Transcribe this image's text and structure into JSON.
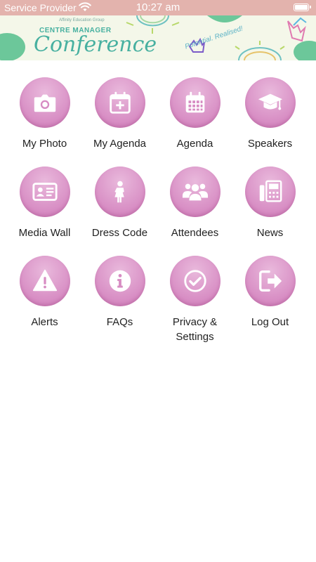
{
  "status_bar": {
    "carrier": "Service Provider",
    "time": "10:27 am"
  },
  "banner": {
    "org": "Affinity Education Group",
    "subtitle": "CENTRE MANAGER",
    "title": "Conference",
    "tagline": "Potential. Realised!"
  },
  "menu": {
    "items": [
      {
        "label": "My Photo",
        "icon": "camera-icon"
      },
      {
        "label": "My Agenda",
        "icon": "calendar-plus-icon"
      },
      {
        "label": "Agenda",
        "icon": "calendar-icon"
      },
      {
        "label": "Speakers",
        "icon": "graduation-cap-icon"
      },
      {
        "label": "Media Wall",
        "icon": "id-card-icon"
      },
      {
        "label": "Dress Code",
        "icon": "person-dress-icon"
      },
      {
        "label": "Attendees",
        "icon": "people-group-icon"
      },
      {
        "label": "News",
        "icon": "fax-icon"
      },
      {
        "label": "Alerts",
        "icon": "warning-icon"
      },
      {
        "label": "FAQs",
        "icon": "info-icon"
      },
      {
        "label": "Privacy & Settings",
        "icon": "check-circle-icon"
      },
      {
        "label": "Log Out",
        "icon": "logout-icon"
      }
    ]
  },
  "colors": {
    "status_bar": "#e3b3ad",
    "tile": "#d78cc3",
    "banner_title": "#47b0a0"
  }
}
